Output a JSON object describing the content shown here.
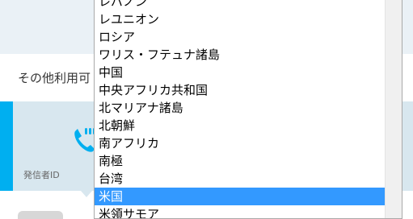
{
  "background": {
    "label": "その他利用可",
    "caller_id_label": "発信者ID"
  },
  "listbox": {
    "items": [
      "レバノン",
      "レユニオン",
      "ロシア",
      "ワリス・フテュナ諸島",
      "中国",
      "中央アフリカ共和国",
      "北マリアナ諸島",
      "北朝鮮",
      "南アフリカ",
      "南極",
      "台湾",
      "米国",
      "米領サモア"
    ],
    "selected_index": 11
  },
  "colors": {
    "accent": "#00aff0",
    "selection": "#3399ff",
    "card": "#d8e7ef"
  },
  "icons": {
    "phone": "phone-icon"
  }
}
